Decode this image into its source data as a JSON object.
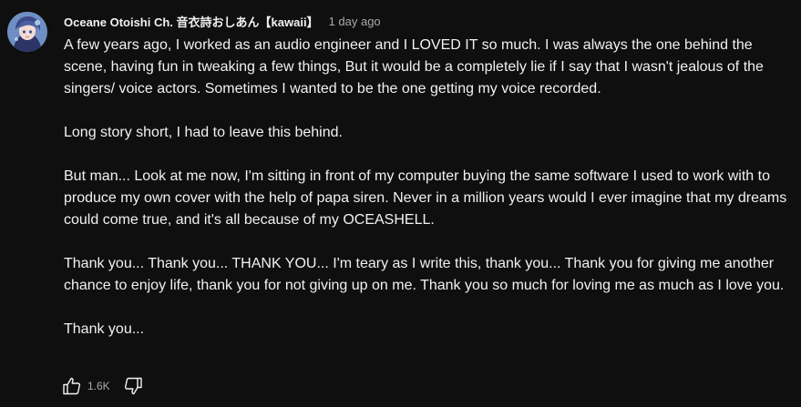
{
  "comment": {
    "author": "Oceane Otoishi Ch. 音衣詩おしあん【kawaii】",
    "timestamp": "1 day ago",
    "paragraphs": [
      "A few years ago, I worked as an audio engineer and I LOVED IT so much. I was always the one behind the scene, having fun in tweaking a few things, But it would be a completely lie if I say that I  wasn't jealous of the singers/ voice actors. Sometimes I wanted to be the one getting my voice recorded.",
      "Long story short, I had to leave this behind.",
      "But man... Look at me now, I'm sitting in front of my computer buying the same software I used to work with to produce my own cover with the help of papa siren. Never in a million years would I ever imagine that my dreams could come true, and it's all because of my OCEASHELL.",
      "Thank you... Thank you... THANK YOU... I'm teary as I write this, thank you... Thank you for giving me another chance to enjoy life, thank you for not giving up on me. Thank you so much for loving me as much as I love you.",
      "Thank you..."
    ],
    "like_count": "1.6K",
    "icons": {
      "like": "thumbs-up-icon",
      "dislike": "thumbs-down-icon"
    }
  },
  "colors": {
    "background": "#0f0f0f",
    "text_primary": "#f1f1f1",
    "text_secondary": "#aaaaaa"
  }
}
